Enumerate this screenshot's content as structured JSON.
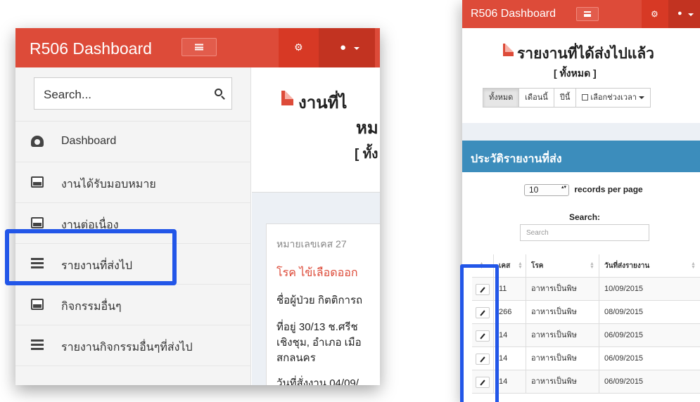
{
  "left": {
    "brand": "R506 Dashboard",
    "search_placeholder": "Search...",
    "sidebar": [
      {
        "label": "Dashboard",
        "icon": "dashboard-icon"
      },
      {
        "label": "งานได้รับมอบหมาย",
        "icon": "inbox-icon"
      },
      {
        "label": "งานต่อเนื่อง",
        "icon": "inbox-icon"
      },
      {
        "label": "รายงานที่ส่งไป",
        "icon": "list-icon"
      },
      {
        "label": "กิจกรรมอื่นๆ",
        "icon": "inbox-icon"
      },
      {
        "label": "รายงานกิจกรรมอื่นๆที่ส่งไป",
        "icon": "list-icon"
      }
    ],
    "content": {
      "title_line1": "งานที่ไ",
      "title_line2": "หม",
      "subtitle": "[ ทั้ง",
      "card": {
        "case_label": "หมายเลขเคส",
        "case_no": "27",
        "disease": "โรค ไข้เลือดออก",
        "patient": "ชื่อผู้ป่วย กิตติการถ",
        "addr1": "ที่อยู่  30/13 ช.ศรีช",
        "addr2": "เชิงชุม,  อำเภอ เมือ",
        "addr3": "สกลนคร",
        "date": "วันที่สั่งงาน 04/09/"
      }
    }
  },
  "right": {
    "brand": "R506 Dashboard",
    "title": "รายงานที่ได้ส่งไปแล้ว",
    "subtitle": "[ ทั้งหมด ]",
    "filters": [
      "ทั้งหมด",
      "เดือนนี้",
      "ปีนี้",
      "เลือกช่วงเวลา"
    ],
    "panel_title": "ประวัติรายงานที่ส่ง",
    "records_value": "10",
    "records_label": "records per page",
    "search_label": "Search:",
    "search_placeholder": "Search",
    "columns": [
      "เคส",
      "โรค",
      "วันที่ส่งรายงาน"
    ],
    "rows": [
      {
        "case": "11",
        "disease": "อาหารเป็นพิษ",
        "date": "10/09/2015"
      },
      {
        "case": "266",
        "disease": "อาหารเป็นพิษ",
        "date": "08/09/2015"
      },
      {
        "case": "14",
        "disease": "อาหารเป็นพิษ",
        "date": "06/09/2015"
      },
      {
        "case": "14",
        "disease": "อาหารเป็นพิษ",
        "date": "06/09/2015"
      },
      {
        "case": "14",
        "disease": "อาหารเป็นพิษ",
        "date": "06/09/2015"
      }
    ]
  },
  "colors": {
    "navbar": "#dd4b39",
    "panel_header": "#3c8dbc",
    "highlight": "#2256e8"
  }
}
